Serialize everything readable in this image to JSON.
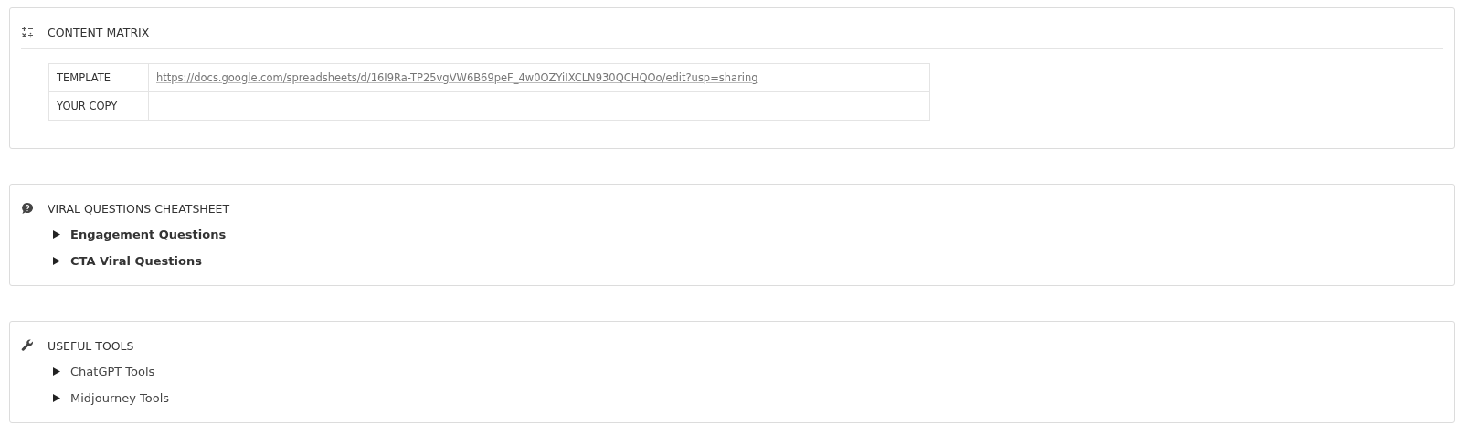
{
  "sections": [
    {
      "title": "CONTENT MATRIX",
      "kind": "math",
      "table": [
        {
          "label": "TEMPLATE",
          "value": "https://docs.google.com/spreadsheets/d/16I9Ra-TP25vgVW6B69peF_4w0OZYiIXCLN930QCHQOo/edit?usp=sharing"
        },
        {
          "label": "YOUR COPY"
        }
      ]
    },
    {
      "title": "VIRAL QUESTIONS CHEATSHEET",
      "kind": "question",
      "toggles": [
        {
          "label": "Engagement Questions",
          "expanded": false,
          "bold": true
        },
        {
          "label": "CTA Viral Questions",
          "expanded": false,
          "bold": true
        }
      ]
    },
    {
      "title": "USEFUL TOOLS",
      "kind": "wrench",
      "toggles": [
        {
          "label": "ChatGPT Tools",
          "expanded": false,
          "bold": false
        },
        {
          "label": "Midjourney Tools",
          "expanded": false,
          "bold": false
        }
      ]
    }
  ]
}
